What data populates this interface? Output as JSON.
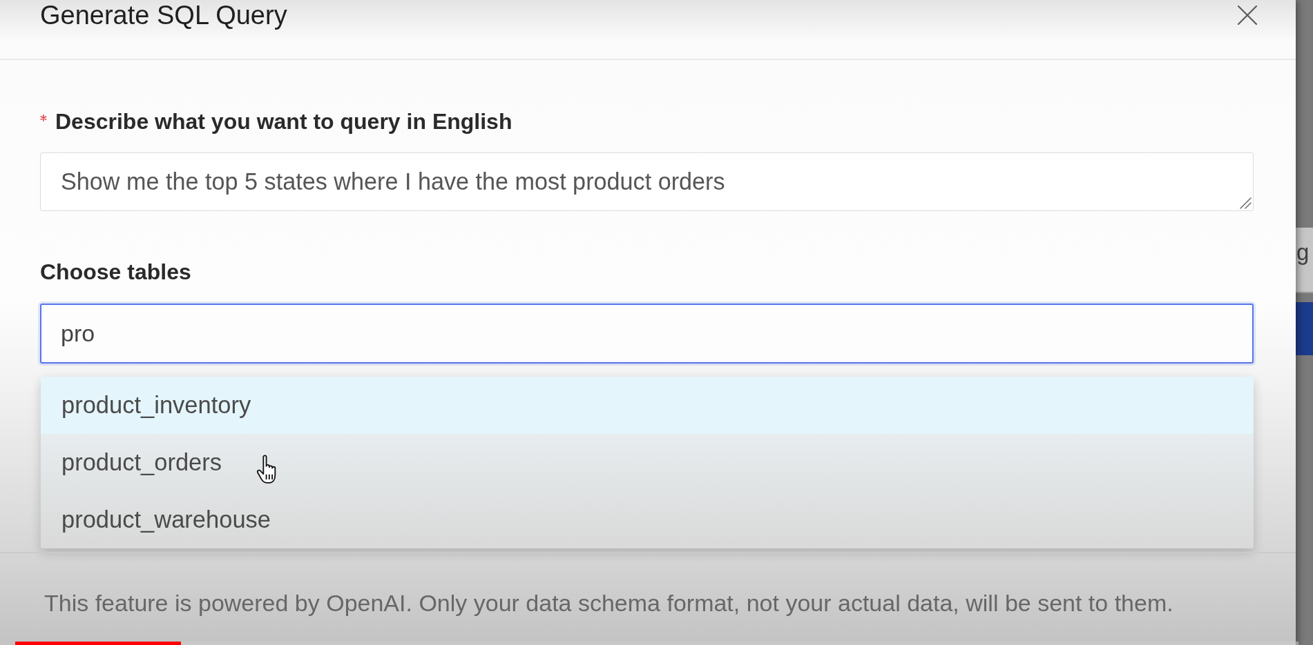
{
  "dialog": {
    "title": "Generate SQL Query"
  },
  "fields": [
    {
      "kind": "textarea",
      "label": "Describe what you want to query in English",
      "required": true,
      "value": "Show me the top 5 states where I have the most product orders"
    },
    {
      "kind": "search-select",
      "label": "Choose tables",
      "required": false,
      "value": "pro",
      "focused": true,
      "expanded": true,
      "options": [
        {
          "label": "product_inventory",
          "selected": true
        },
        {
          "label": "product_orders",
          "selected": false
        },
        {
          "label": "product_warehouse",
          "selected": false
        }
      ]
    }
  ],
  "footer": {
    "note": "This feature is powered by OpenAI. Only your data schema format, not your actual data, will be sent to them."
  },
  "background_app": {
    "text": "g"
  },
  "video_progress": {
    "level": 0.129
  }
}
